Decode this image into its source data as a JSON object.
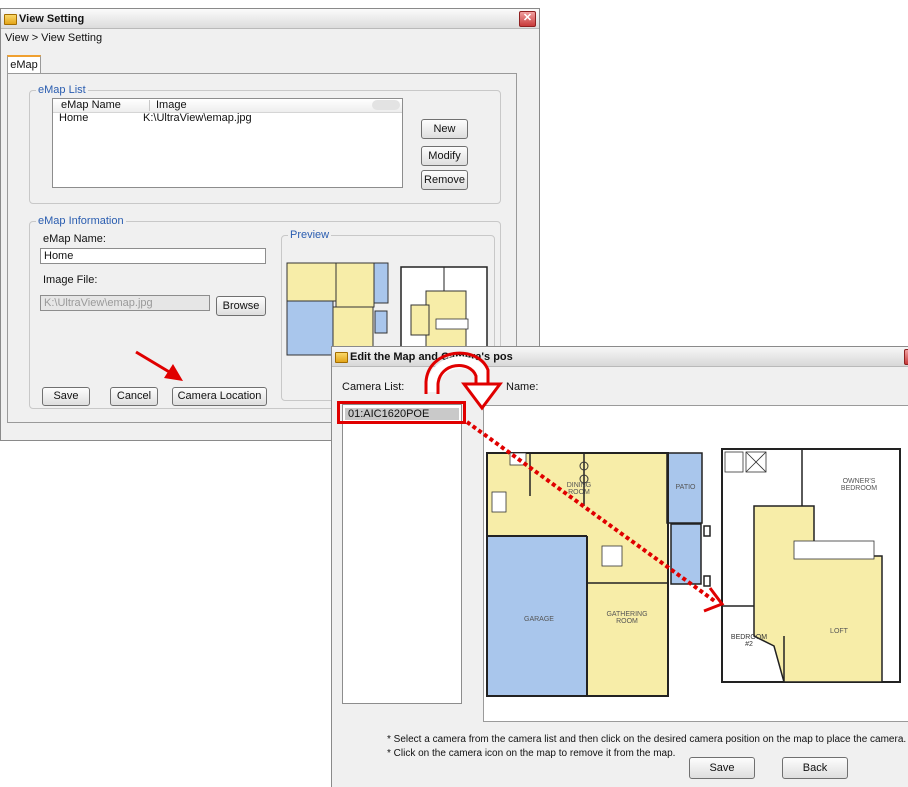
{
  "view_setting": {
    "title": "View Setting",
    "close_glyph": "✕",
    "breadcrumb": "View > View Setting",
    "tab": "eMap",
    "emap_list": {
      "legend": "eMap List",
      "columns": [
        "eMap Name",
        "Image"
      ],
      "rows": [
        {
          "name": "Home",
          "image": "K:\\UltraView\\emap.jpg"
        }
      ],
      "buttons": {
        "new": "New",
        "modify": "Modify",
        "remove": "Remove"
      }
    },
    "emap_info": {
      "legend": "eMap Information",
      "name_label": "eMap Name:",
      "name_value": "Home",
      "image_file_label": "Image File:",
      "image_file_value": "K:\\UltraView\\emap.jpg",
      "browse": "Browse",
      "preview_legend": "Preview",
      "save": "Save",
      "cancel": "Cancel",
      "camera_location": "Camera Location"
    }
  },
  "edit_dialog": {
    "title": "Edit the Map and Camera's pos",
    "camera_list_label": "Camera List:",
    "name_label": "Name:",
    "cameras": [
      "01:AIC1620POE"
    ],
    "floorplan_labels": {
      "dining": "DINING\nROOM",
      "patio": "PATIO",
      "garage": "GARAGE",
      "gathering": "GATHERING\nROOM",
      "owners": "OWNER'S\nBEDROOM",
      "loft": "LOFT",
      "bedroom2": "BEDROOM\n#2"
    },
    "instructions": [
      "* Select a camera from the camera list and then click on the desired camera position on the map to place the camera.",
      "* Click on the camera icon on the map to remove it from the map."
    ],
    "save": "Save",
    "back": "Back"
  },
  "colors": {
    "annotation_red": "#e00000",
    "room_yellow": "#f7eda8",
    "garage_blue": "#a9c6ec",
    "legend_blue": "#2a5db0"
  }
}
